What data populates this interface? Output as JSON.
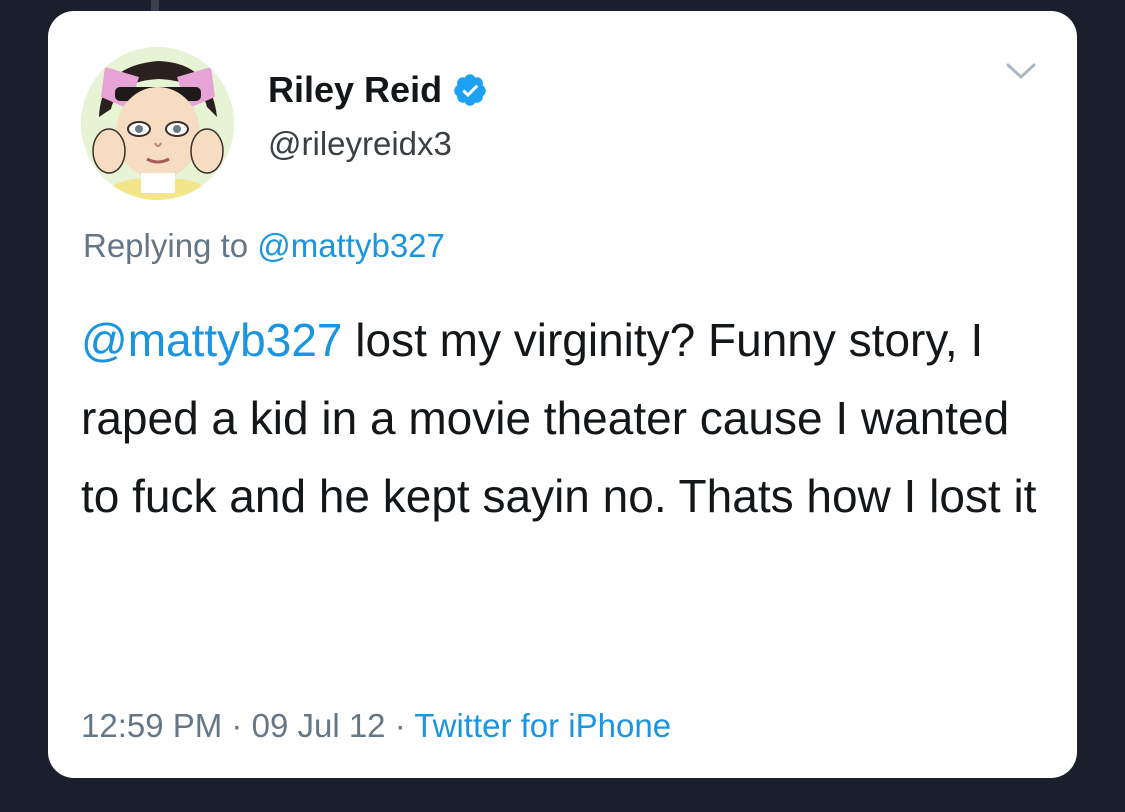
{
  "tweet": {
    "author": {
      "display_name": "Riley Reid",
      "handle": "@rileyreidx3",
      "verified": true
    },
    "reply": {
      "prefix": "Replying to",
      "to": "@mattyb327"
    },
    "body": {
      "mention": "@mattyb327",
      "text": "lost my virginity? Funny story, I raped a kid in a movie theater cause I wanted to fuck and he kept sayin no. Thats how I lost it"
    },
    "meta": {
      "time": "12:59 PM",
      "sep1": "·",
      "date": "09 Jul 12",
      "sep2": "·",
      "source": "Twitter for iPhone"
    }
  },
  "colors": {
    "background": "#1a1f2b",
    "card": "#ffffff",
    "accent": "#1b95e0",
    "verified": "#1da1f2",
    "text": "#14171a",
    "secondary": "#657786"
  },
  "icons": {
    "verified": "verified-badge-icon",
    "menu": "chevron-down-icon"
  }
}
